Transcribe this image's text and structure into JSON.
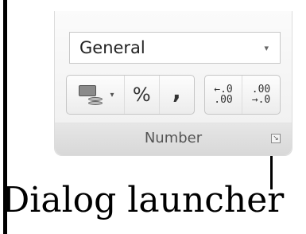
{
  "ribbon_group": {
    "number_format": {
      "selected": "General",
      "arrow": "▾"
    },
    "accounting": {
      "caret": "▾"
    },
    "percent_label": "%",
    "comma_label": ",",
    "increase_decimal": {
      "top": "←.0",
      "bottom": ".00"
    },
    "decrease_decimal": {
      "top": ".00",
      "bottom": "→.0"
    },
    "group_label": "Number",
    "launcher_glyph": "↘"
  },
  "callout": {
    "text": "Dialog launcher"
  },
  "icons": {
    "accounting": "accounting-number-format-icon",
    "increase_decimal": "increase-decimal-icon",
    "decrease_decimal": "decrease-decimal-icon",
    "launcher": "dialog-launcher-icon"
  },
  "colors": {
    "panel_bg": "#f3f3f3",
    "label_bar": "#dedede",
    "border": "#c6c6c6",
    "callout": "#000000"
  }
}
